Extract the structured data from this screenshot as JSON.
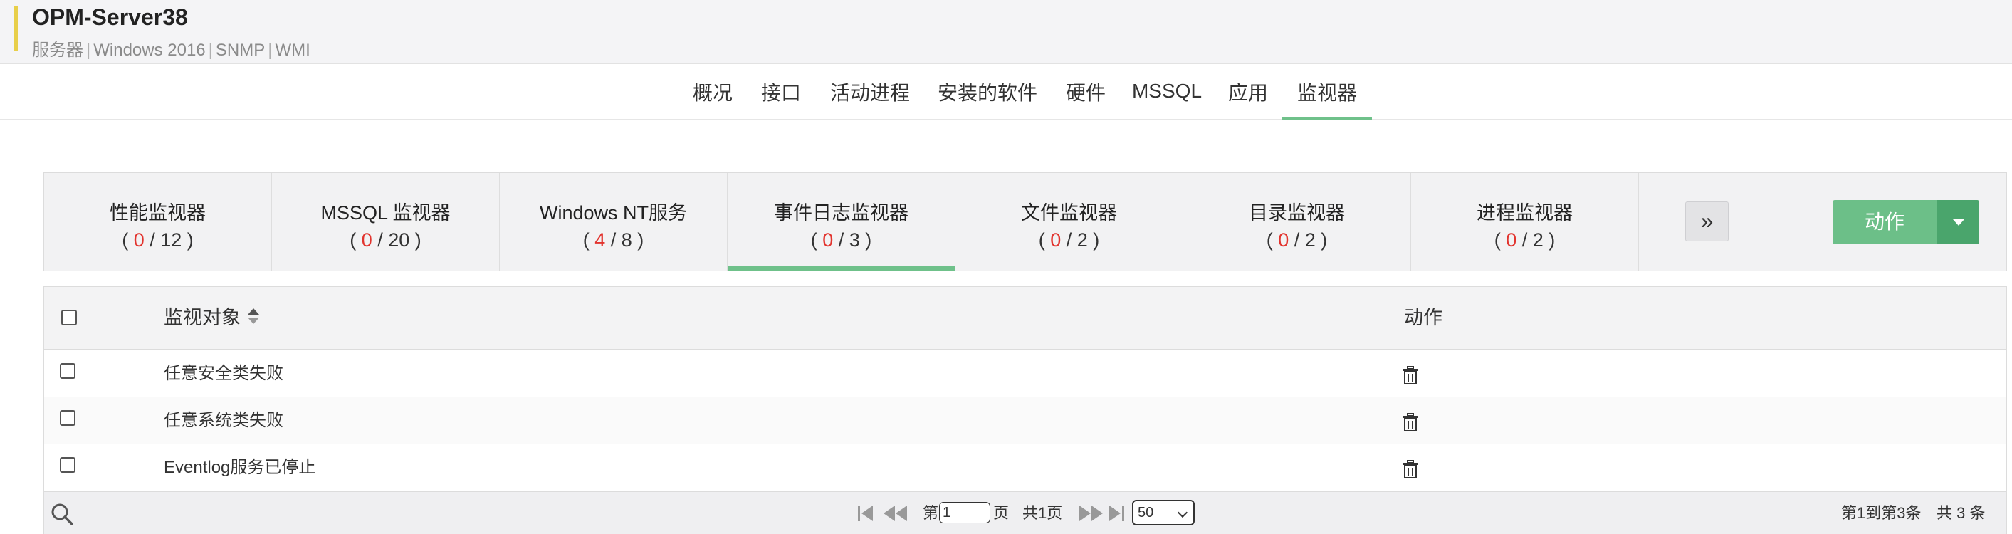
{
  "header": {
    "title": "OPM-Server38",
    "meta": [
      "服务器",
      "Windows 2016",
      "SNMP",
      "WMI"
    ]
  },
  "nav": {
    "tabs": [
      "概况",
      "接口",
      "活动进程",
      "安装的软件",
      "硬件",
      "MSSQL",
      "应用",
      "监视器"
    ],
    "active": "监视器"
  },
  "monitor_tabs": [
    {
      "name": "性能监视器",
      "red": "0",
      "total": "12"
    },
    {
      "name": "MSSQL 监视器",
      "red": "0",
      "total": "20"
    },
    {
      "name": "Windows NT服务",
      "red": "4",
      "total": "8"
    },
    {
      "name": "事件日志监视器",
      "red": "0",
      "total": "3"
    },
    {
      "name": "文件监视器",
      "red": "0",
      "total": "2"
    },
    {
      "name": "目录监视器",
      "red": "0",
      "total": "2"
    },
    {
      "name": "进程监视器",
      "red": "0",
      "total": "2"
    }
  ],
  "monitor_tabs_active": "事件日志监视器",
  "action_button": {
    "label": "动作"
  },
  "table": {
    "columns": {
      "target": "监视对象",
      "action": "动作"
    },
    "rows": [
      {
        "name": "任意安全类失败"
      },
      {
        "name": "任意系统类失败"
      },
      {
        "name": "Eventlog服务已停止"
      }
    ]
  },
  "pager": {
    "page_prefix": "第",
    "page_value": "1",
    "page_suffix": "页",
    "total_pages": "共1页",
    "page_size": "50",
    "summary": "第1到第3条",
    "total_records": "共 3 条"
  },
  "colors": {
    "accent_green": "#6fc18a",
    "action_green": "#6cbf88",
    "count_red": "#e2342e",
    "header_accent": "#e8cf4a"
  }
}
